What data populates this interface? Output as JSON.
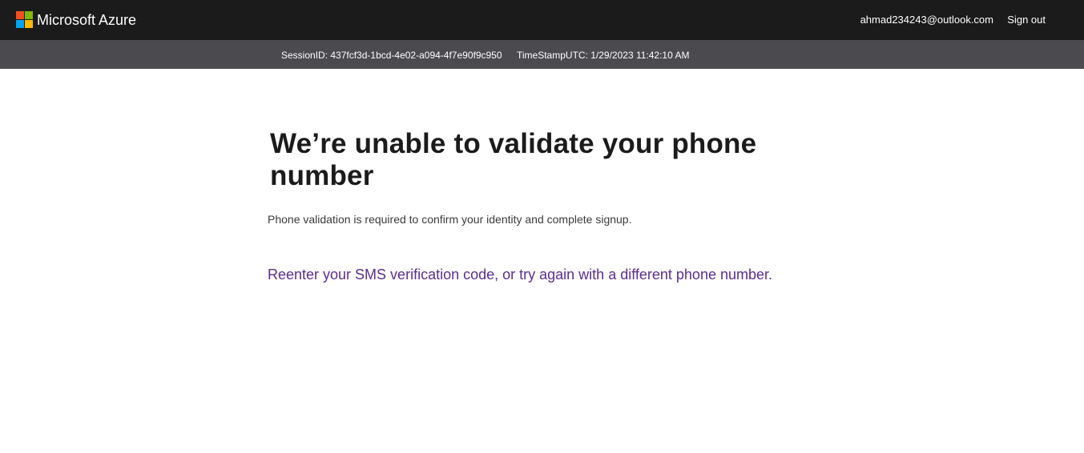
{
  "header": {
    "brand": "Microsoft Azure",
    "logo_icon": "microsoft-logo-icon",
    "user_email": "ahmad234243@outlook.com",
    "sign_out_label": "Sign out",
    "background": "#1b1b1b"
  },
  "session": {
    "session_id": "SessionID: 437fcf3d-1bcd-4e02-a094-4f7e90f9c950",
    "timestamp": "TimeStampUTC: 1/29/2023 11:42:10 AM",
    "background": "#4b4b4f"
  },
  "main": {
    "title": "We’re unable to validate your phone number",
    "description": "Phone validation is required to confirm your identity and complete signup.",
    "action_link": "Reenter your SMS verification code, or try again with a different phone number.",
    "link_color": "#5c2d91"
  }
}
